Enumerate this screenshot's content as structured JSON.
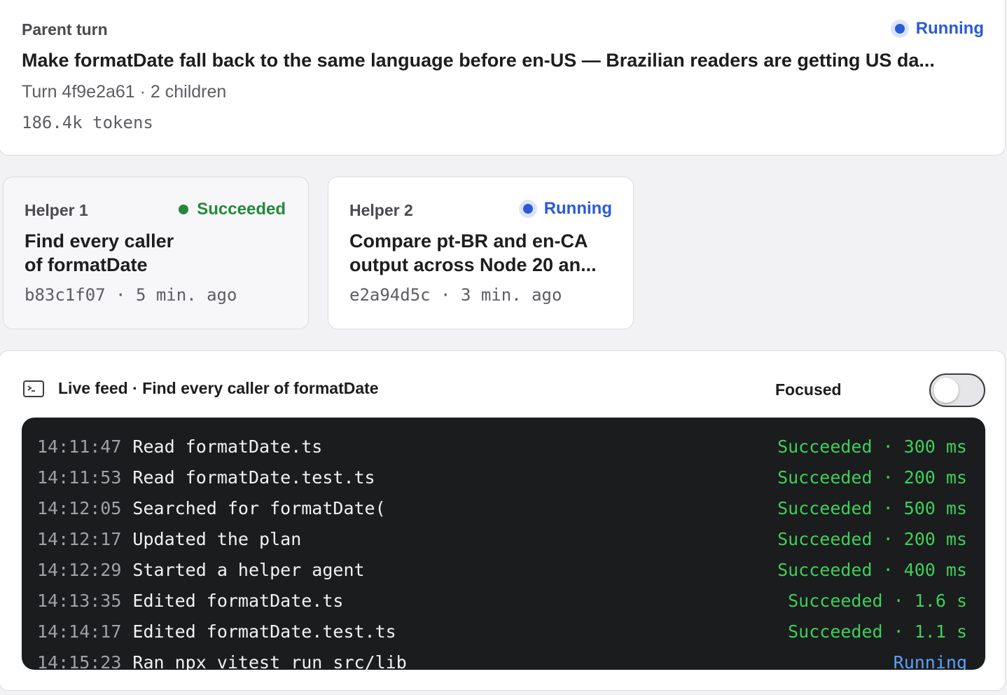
{
  "parent": {
    "eyebrow": "Parent turn",
    "status": "Running",
    "title": "Make formatDate fall back to the same language before en-US — Brazilian readers are getting US da...",
    "meta": "Turn 4f9e2a61 · 2 children",
    "tokens": "186.4k tokens"
  },
  "helpers": [
    {
      "eyebrow": "Helper 1",
      "status": "Succeeded",
      "title_line1": "Find every caller",
      "title_line2": "of formatDate",
      "meta": "b83c1f07 · 5 min. ago"
    },
    {
      "eyebrow": "Helper 2",
      "status": "Running",
      "title_line1": "Compare pt-BR and en-CA",
      "title_line2": "output across Node 20 an...",
      "meta": "e2a94d5c · 3 min. ago"
    }
  ],
  "feed": {
    "title": "Live feed · Find every caller of formatDate",
    "focused_label": "Focused",
    "focused_on": false,
    "rows": [
      {
        "time": "14:11:47",
        "message": "Read formatDate.ts",
        "status": "Succeeded · 300 ms"
      },
      {
        "time": "14:11:53",
        "message": "Read formatDate.test.ts",
        "status": "Succeeded · 200 ms"
      },
      {
        "time": "14:12:05",
        "message": "Searched for formatDate(",
        "status": "Succeeded · 500 ms"
      },
      {
        "time": "14:12:17",
        "message": "Updated the plan",
        "status": "Succeeded · 200 ms"
      },
      {
        "time": "14:12:29",
        "message": "Started a helper agent",
        "status": "Succeeded · 400 ms"
      },
      {
        "time": "14:13:35",
        "message": "Edited formatDate.ts",
        "status": "Succeeded · 1.6 s"
      },
      {
        "time": "14:14:17",
        "message": "Edited formatDate.test.ts",
        "status": "Succeeded · 1.1 s"
      },
      {
        "time": "14:15:23",
        "message": "Ran npx vitest run src/lib",
        "status": "Running"
      }
    ]
  },
  "colors": {
    "running": "#2a5bd7",
    "succeeded": "#228a3b",
    "terminal_bg": "#1b1c1e",
    "terminal_success": "#3ecf5a",
    "terminal_running": "#5aa2f5"
  }
}
